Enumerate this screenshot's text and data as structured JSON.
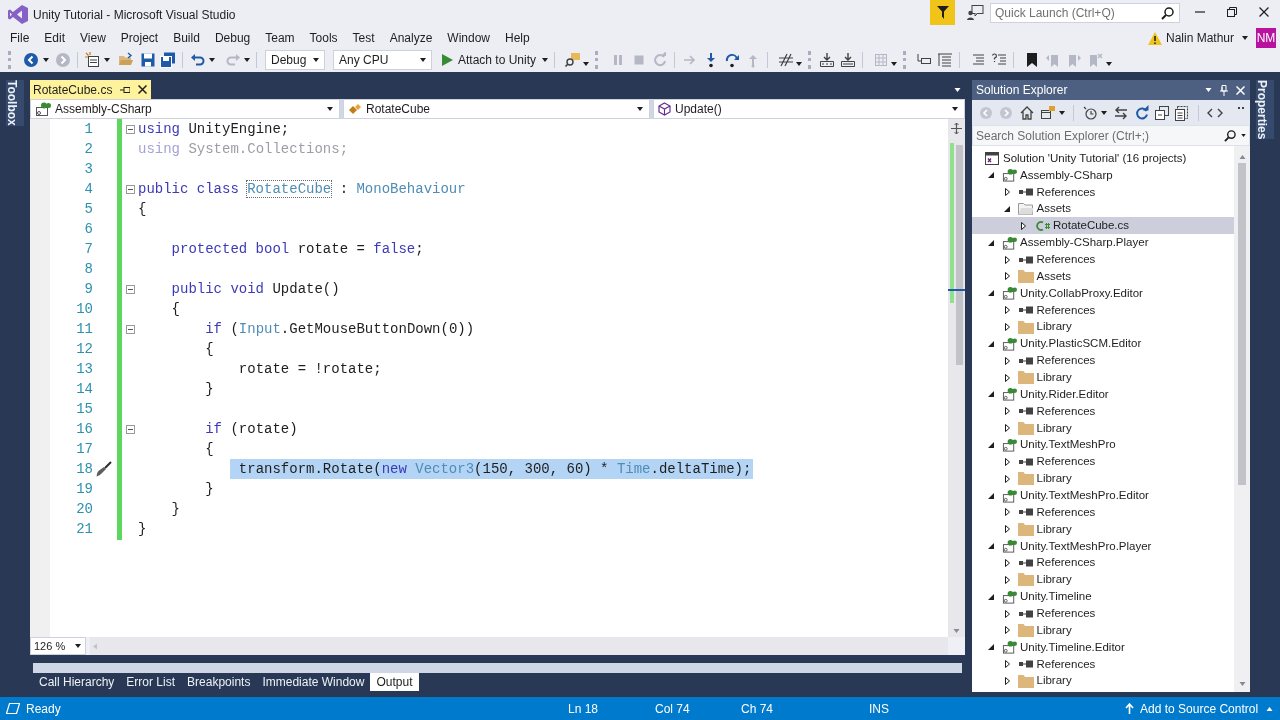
{
  "window": {
    "title": "Unity Tutorial - Microsoft Visual Studio",
    "quick_launch": {
      "placeholder": "Quick Launch (Ctrl+Q)"
    }
  },
  "menu": [
    "File",
    "Edit",
    "View",
    "Project",
    "Build",
    "Debug",
    "Team",
    "Tools",
    "Test",
    "Analyze",
    "Window",
    "Help"
  ],
  "account": {
    "name": "Nalin Mathur",
    "initials": "NM"
  },
  "toolbar": {
    "configuration": "Debug",
    "platform": "Any CPU",
    "start_label": "Attach to Unity"
  },
  "side_tabs": {
    "left": "Toolbox",
    "right": "Properties"
  },
  "document_tabs": [
    {
      "label": "RotateCube.cs",
      "selected": true
    }
  ],
  "navigation_bar": {
    "project": "Assembly-CSharp",
    "type": "RotateCube",
    "member": "Update()"
  },
  "editor": {
    "zoom": "126 %",
    "lines": [
      {
        "number": "1",
        "collapsible": true,
        "hint": false,
        "selected": false,
        "tokens": [
          {
            "kind": "keyword",
            "text": "using"
          },
          {
            "kind": "plain",
            "text": " UnityEngine;"
          }
        ]
      },
      {
        "number": "2",
        "collapsible": false,
        "hint": false,
        "selected": false,
        "tokens": [
          {
            "kind": "unused_keyword",
            "text": "using"
          },
          {
            "kind": "unused",
            "text": " System.Collections;"
          }
        ]
      },
      {
        "number": "3",
        "collapsible": false,
        "hint": false,
        "selected": false
      },
      {
        "number": "4",
        "collapsible": true,
        "hint": false,
        "selected": false,
        "tokens": [
          {
            "kind": "keyword",
            "text": "public class "
          },
          {
            "kind": "renamed_type",
            "text": "RotateCube"
          },
          {
            "kind": "plain",
            "text": " : "
          },
          {
            "kind": "type",
            "text": "MonoBehaviour"
          }
        ]
      },
      {
        "number": "5",
        "collapsible": false,
        "hint": false,
        "selected": false,
        "tokens": [
          {
            "kind": "plain",
            "text": "{"
          }
        ]
      },
      {
        "number": "6",
        "collapsible": false,
        "hint": false,
        "selected": false
      },
      {
        "number": "7",
        "collapsible": false,
        "hint": false,
        "selected": false,
        "tokens": [
          {
            "kind": "keyword",
            "text": "    protected bool"
          },
          {
            "kind": "plain",
            "text": " rotate = "
          },
          {
            "kind": "keyword",
            "text": "false"
          },
          {
            "kind": "plain",
            "text": ";"
          }
        ]
      },
      {
        "number": "8",
        "collapsible": false,
        "hint": false,
        "selected": false
      },
      {
        "number": "9",
        "collapsible": true,
        "hint": false,
        "selected": false,
        "tokens": [
          {
            "kind": "keyword",
            "text": "    public void"
          },
          {
            "kind": "plain",
            "text": " Update()"
          }
        ]
      },
      {
        "number": "10",
        "collapsible": false,
        "hint": false,
        "selected": false,
        "tokens": [
          {
            "kind": "plain",
            "text": "    {"
          }
        ]
      },
      {
        "number": "11",
        "collapsible": true,
        "hint": false,
        "selected": false,
        "tokens": [
          {
            "kind": "keyword",
            "text": "        if"
          },
          {
            "kind": "plain",
            "text": " ("
          },
          {
            "kind": "type",
            "text": "Input"
          },
          {
            "kind": "plain",
            "text": ".GetMouseButtonDown(0))"
          }
        ]
      },
      {
        "number": "12",
        "collapsible": false,
        "hint": false,
        "selected": false,
        "tokens": [
          {
            "kind": "plain",
            "text": "        {"
          }
        ]
      },
      {
        "number": "13",
        "collapsible": false,
        "hint": false,
        "selected": false,
        "tokens": [
          {
            "kind": "plain",
            "text": "            rotate = !rotate;"
          }
        ]
      },
      {
        "number": "14",
        "collapsible": false,
        "hint": false,
        "selected": false,
        "tokens": [
          {
            "kind": "plain",
            "text": "        }"
          }
        ]
      },
      {
        "number": "15",
        "collapsible": false,
        "hint": false,
        "selected": false
      },
      {
        "number": "16",
        "collapsible": true,
        "hint": false,
        "selected": false,
        "tokens": [
          {
            "kind": "keyword",
            "text": "        if"
          },
          {
            "kind": "plain",
            "text": " (rotate)"
          }
        ]
      },
      {
        "number": "17",
        "collapsible": false,
        "hint": false,
        "selected": false,
        "tokens": [
          {
            "kind": "plain",
            "text": "        {"
          }
        ]
      },
      {
        "number": "18",
        "collapsible": false,
        "hint": true,
        "selected": true,
        "tokens": [
          {
            "kind": "plain",
            "text": "            transform.Rotate("
          },
          {
            "kind": "keyword",
            "text": "new "
          },
          {
            "kind": "type",
            "text": "Vector3"
          },
          {
            "kind": "plain",
            "text": "(150, 300, 60) * "
          },
          {
            "kind": "type",
            "text": "Time"
          },
          {
            "kind": "plain",
            "text": ".deltaTime);"
          }
        ]
      },
      {
        "number": "19",
        "collapsible": false,
        "hint": false,
        "selected": false,
        "tokens": [
          {
            "kind": "plain",
            "text": "        }"
          }
        ]
      },
      {
        "number": "20",
        "collapsible": false,
        "hint": false,
        "selected": false,
        "tokens": [
          {
            "kind": "plain",
            "text": "    }"
          }
        ]
      },
      {
        "number": "21",
        "collapsible": false,
        "hint": false,
        "selected": false,
        "tokens": [
          {
            "kind": "plain",
            "text": "}"
          }
        ]
      }
    ]
  },
  "tool_tabs": [
    {
      "label": "Call Hierarchy",
      "selected": false
    },
    {
      "label": "Error List",
      "selected": false
    },
    {
      "label": "Breakpoints",
      "selected": false
    },
    {
      "label": "Immediate Window",
      "selected": false
    },
    {
      "label": "Output",
      "selected": true
    }
  ],
  "solution_explorer": {
    "title": "Solution Explorer",
    "search": {
      "placeholder": "Search Solution Explorer (Ctrl+;)"
    },
    "tree": [
      {
        "label": "Solution 'Unity Tutorial' (16 projects)",
        "kind": "solution",
        "selected": false,
        "children": [
          {
            "label": "Assembly-CSharp",
            "kind": "project",
            "expanded": true,
            "selected": false,
            "children": [
              {
                "label": "References",
                "kind": "references",
                "expanded": false,
                "selected": false
              },
              {
                "label": "Assets",
                "kind": "folder",
                "expanded": true,
                "selected": false,
                "children": [
                  {
                    "label": "RotateCube.cs",
                    "kind": "code_file",
                    "expanded": false,
                    "selected": true
                  }
                ]
              }
            ]
          },
          {
            "label": "Assembly-CSharp.Player",
            "kind": "project",
            "expanded": true,
            "selected": false,
            "children": [
              {
                "label": "References",
                "kind": "references",
                "expanded": false,
                "selected": false
              },
              {
                "label": "Assets",
                "kind": "folder",
                "expanded": false,
                "selected": false
              }
            ]
          },
          {
            "label": "Unity.CollabProxy.Editor",
            "kind": "project",
            "expanded": true,
            "selected": false,
            "children": [
              {
                "label": "References",
                "kind": "references",
                "expanded": false,
                "selected": false
              },
              {
                "label": "Library",
                "kind": "folder",
                "expanded": false,
                "selected": false
              }
            ]
          },
          {
            "label": "Unity.PlasticSCM.Editor",
            "kind": "project",
            "expanded": true,
            "selected": false,
            "children": [
              {
                "label": "References",
                "kind": "references",
                "expanded": false,
                "selected": false
              },
              {
                "label": "Library",
                "kind": "folder",
                "expanded": false,
                "selected": false
              }
            ]
          },
          {
            "label": "Unity.Rider.Editor",
            "kind": "project",
            "expanded": true,
            "selected": false,
            "children": [
              {
                "label": "References",
                "kind": "references",
                "expanded": false,
                "selected": false
              },
              {
                "label": "Library",
                "kind": "folder",
                "expanded": false,
                "selected": false
              }
            ]
          },
          {
            "label": "Unity.TextMeshPro",
            "kind": "project",
            "expanded": true,
            "selected": false,
            "children": [
              {
                "label": "References",
                "kind": "references",
                "expanded": false,
                "selected": false
              },
              {
                "label": "Library",
                "kind": "folder",
                "expanded": false,
                "selected": false
              }
            ]
          },
          {
            "label": "Unity.TextMeshPro.Editor",
            "kind": "project",
            "expanded": true,
            "selected": false,
            "children": [
              {
                "label": "References",
                "kind": "references",
                "expanded": false,
                "selected": false
              },
              {
                "label": "Library",
                "kind": "folder",
                "expanded": false,
                "selected": false
              }
            ]
          },
          {
            "label": "Unity.TextMeshPro.Player",
            "kind": "project",
            "expanded": true,
            "selected": false,
            "children": [
              {
                "label": "References",
                "kind": "references",
                "expanded": false,
                "selected": false
              },
              {
                "label": "Library",
                "kind": "folder",
                "expanded": false,
                "selected": false
              }
            ]
          },
          {
            "label": "Unity.Timeline",
            "kind": "project",
            "expanded": true,
            "selected": false,
            "children": [
              {
                "label": "References",
                "kind": "references",
                "expanded": false,
                "selected": false
              },
              {
                "label": "Library",
                "kind": "folder",
                "expanded": false,
                "selected": false
              }
            ]
          },
          {
            "label": "Unity.Timeline.Editor",
            "kind": "project",
            "expanded": true,
            "selected": false,
            "children": [
              {
                "label": "References",
                "kind": "references",
                "expanded": false,
                "selected": false
              },
              {
                "label": "Library",
                "kind": "folder",
                "expanded": false,
                "selected": false
              }
            ]
          }
        ]
      }
    ]
  },
  "status_bar": {
    "message": "Ready",
    "line": "Ln 18",
    "column": "Col 74",
    "character": "Ch 74",
    "insert_mode": "INS",
    "source_control": "Add to Source Control"
  }
}
